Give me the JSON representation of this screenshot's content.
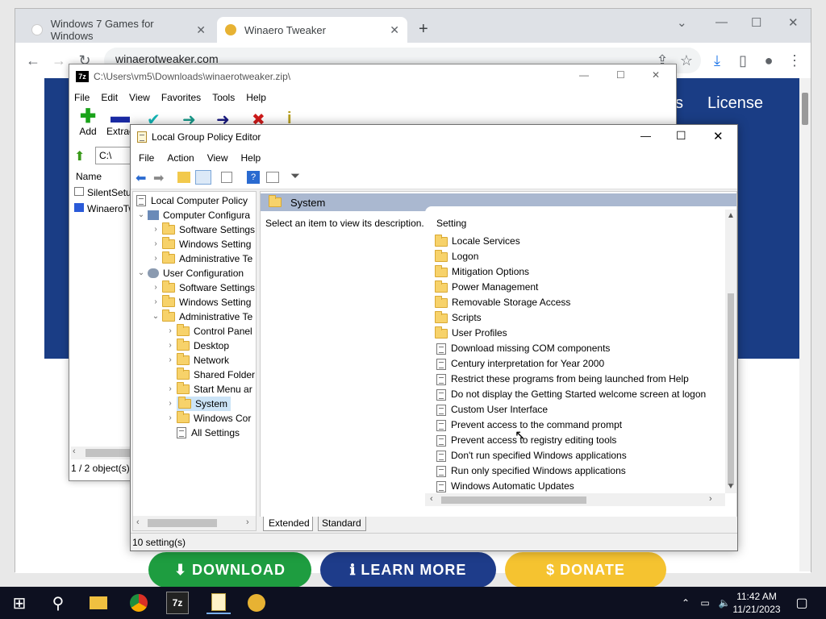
{
  "browser": {
    "tabs": [
      {
        "label": "Windows 7 Games for Windows"
      },
      {
        "label": "Winaero Tweaker"
      }
    ],
    "url": "winaerotweaker.com",
    "page_nav_license": "License",
    "page_nav_partial": "s",
    "buttons": {
      "download": "⬇ DOWNLOAD",
      "learn": "ℹ LEARN MORE",
      "donate": "$ DONATE"
    },
    "colors": {
      "download": "#1e9d40",
      "learn": "#1e3c8a",
      "donate": "#f5c330",
      "page": "#1a3d85"
    }
  },
  "sevenzip": {
    "title": "C:\\Users\\vm5\\Downloads\\winaerotweaker.zip\\",
    "menu": [
      "File",
      "Edit",
      "View",
      "Favorites",
      "Tools",
      "Help"
    ],
    "toolbar": [
      {
        "label": "Add",
        "icon": "plus-icon"
      },
      {
        "label": "Extrac",
        "icon": "minus-icon"
      }
    ],
    "path": "C:\\",
    "column_name": "Name",
    "files": [
      "SilentSetu",
      "WinaeroTw"
    ],
    "status": "1 / 2 object(s)"
  },
  "gpe": {
    "title": "Local Group Policy Editor",
    "menu": [
      "File",
      "Action",
      "View",
      "Help"
    ],
    "tree": {
      "root": "Local Computer Policy",
      "computer": "Computer Configura",
      "c_software": "Software Settings",
      "c_windows": "Windows Setting",
      "c_admin": "Administrative Te",
      "user": "User Configuration",
      "u_software": "Software Settings",
      "u_windows": "Windows Setting",
      "u_admin": "Administrative Te",
      "control": "Control Panel",
      "desktop": "Desktop",
      "network": "Network",
      "shared": "Shared Folder",
      "startmenu": "Start Menu ar",
      "system": "System",
      "wincomp": "Windows Cor",
      "allsettings": "All Settings"
    },
    "header": "System",
    "description": "Select an item to view its description.",
    "column_setting": "Setting",
    "folders": [
      "Locale Services",
      "Logon",
      "Mitigation Options",
      "Power Management",
      "Removable Storage Access",
      "Scripts",
      "User Profiles"
    ],
    "policies": [
      "Download missing COM components",
      "Century interpretation for Year 2000",
      "Restrict these programs from being launched from Help",
      "Do not display the Getting Started welcome screen at logon",
      "Custom User Interface",
      "Prevent access to the command prompt",
      "Prevent access to registry editing tools",
      "Don't run specified Windows applications",
      "Run only specified Windows applications",
      "Windows Automatic Updates"
    ],
    "tabs": [
      "Extended",
      "Standard"
    ],
    "status": "10 setting(s)"
  },
  "taskbar": {
    "time": "11:42 AM",
    "date": "11/21/2023"
  }
}
